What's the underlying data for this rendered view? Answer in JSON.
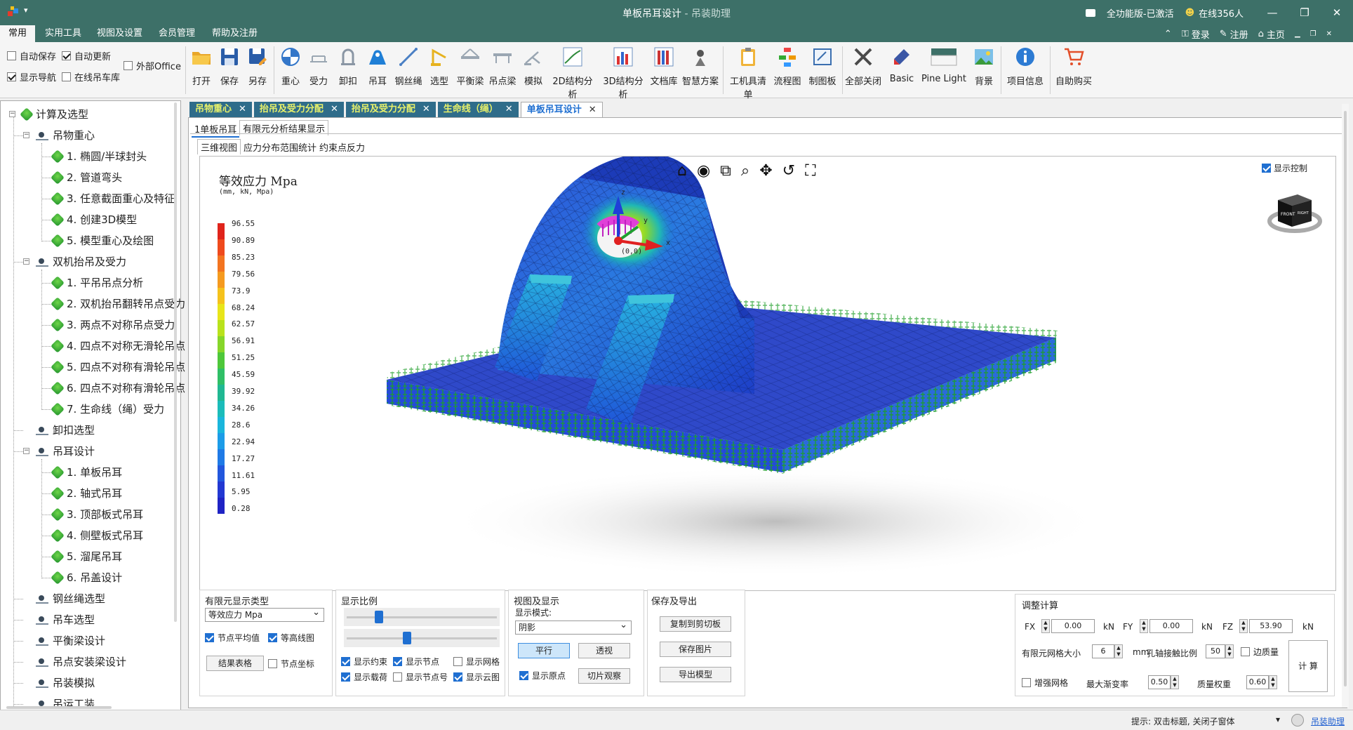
{
  "window": {
    "title": "单板吊耳设计",
    "title_sep": " - ",
    "subtitle": "吊装助理",
    "license": "全功能版-已激活",
    "online": "在线356人"
  },
  "menu": {
    "tabs": [
      "常用",
      "实用工具",
      "视图及设置",
      "会员管理",
      "帮助及注册"
    ],
    "login": "登录",
    "register": "注册",
    "home": "主页"
  },
  "ribbon": {
    "options": {
      "autosave": "自动保存",
      "autoupdate": "自动更新",
      "external_office": "外部Office",
      "show_nav": "显示导航",
      "online_crane_lib": "在线吊车库"
    },
    "buttons": {
      "open": "打开",
      "save": "保存",
      "save_as": "另存",
      "cog": "重心",
      "force": "受力",
      "shackle": "卸扣",
      "lug": "吊耳",
      "wire_rope": "钢丝绳",
      "selection": "选型",
      "spreader": "平衡梁",
      "lifting_beam": "吊点梁",
      "simulate": "模拟",
      "fea2d": "2D结构分析",
      "fea3d": "3D结构分析",
      "doclib": "文档库",
      "smart": "智慧方案",
      "tool_list": "工机具清单",
      "flowchart": "流程图",
      "drawing": "制图板",
      "close_all": "全部关闭",
      "basic": "Basic",
      "pine_light": "Pine Light",
      "background": "背景",
      "project_info": "项目信息",
      "shop": "自助购买"
    }
  },
  "tree": {
    "root": "计算及选型",
    "groups": [
      {
        "label": "吊物重心",
        "items": [
          "1. 椭圆/半球封头",
          "2. 管道弯头",
          "3. 任意截面重心及特征",
          "4. 创建3D模型",
          "5. 模型重心及绘图"
        ]
      },
      {
        "label": "双机抬吊及受力",
        "items": [
          "1. 平吊吊点分析",
          "2. 双机抬吊翻转吊点受力",
          "3. 两点不对称吊点受力",
          "4. 四点不对称无滑轮吊点",
          "5. 四点不对称有滑轮吊点",
          "6. 四点不对称有滑轮吊点",
          "7. 生命线（绳）受力"
        ]
      },
      {
        "label": "卸扣选型",
        "items": []
      },
      {
        "label": "吊耳设计",
        "items": [
          "1. 单板吊耳",
          "2. 轴式吊耳",
          "3. 顶部板式吊耳",
          "4. 侧壁板式吊耳",
          "5. 溜尾吊耳",
          "6. 吊盖设计"
        ]
      },
      {
        "label": "钢丝绳选型",
        "items": []
      },
      {
        "label": "吊车选型",
        "items": []
      },
      {
        "label": "平衡梁设计",
        "items": []
      },
      {
        "label": "吊点安装梁设计",
        "items": []
      },
      {
        "label": "吊装模拟",
        "items": []
      },
      {
        "label": "吊运工装",
        "items": []
      }
    ]
  },
  "doc_tabs": [
    "吊物重心",
    "抬吊及受力分配",
    "抬吊及受力分配",
    "生命线（绳）",
    "单板吊耳设计"
  ],
  "sub_tabs": [
    "1单板吊耳",
    "有限元分析结果显示"
  ],
  "view_tabs": [
    "三维视图",
    "应力分布范围统计",
    "约束点反力"
  ],
  "viewport": {
    "legend_title": "等效应力 Mpa",
    "legend_unit": "(mm, kN, Mpa)",
    "legend_values": [
      "96.55",
      "90.89",
      "85.23",
      "79.56",
      "73.9",
      "68.24",
      "62.57",
      "56.91",
      "51.25",
      "45.59",
      "39.92",
      "34.26",
      "28.6",
      "22.94",
      "17.27",
      "11.61",
      "5.95",
      "0.28"
    ],
    "legend_colors": [
      "#e0241b",
      "#ef4a1d",
      "#f37420",
      "#f59a1f",
      "#f5c21c",
      "#e8e51a",
      "#b9e21c",
      "#86d62a",
      "#4ec83a",
      "#2fbf66",
      "#20b892",
      "#1bbcba",
      "#1ab6dc",
      "#1c9ce8",
      "#1f7ae6",
      "#2257dd",
      "#2238d2",
      "#1f23c4"
    ],
    "display_control": "显示控制",
    "cube_front": "FRONT",
    "cube_right": "RIGHT",
    "origin": "(0,0)",
    "axis_x": "x",
    "axis_y": "y",
    "axis_z": "z"
  },
  "controls": {
    "fe_type": {
      "title": "有限元显示类型",
      "value": "等效应力 Mpa",
      "node_avg": "节点平均值",
      "contour": "等高线图",
      "result_table": "结果表格",
      "node_coords": "节点坐标"
    },
    "scale": {
      "title": "显示比例",
      "show_constraint": "显示约束",
      "show_nodes": "显示节点",
      "show_mesh": "显示网格",
      "show_load": "显示载荷",
      "show_node_no": "显示节点号",
      "show_cloud": "显示云图",
      "slider1": 0.2,
      "slider2": 0.4
    },
    "view": {
      "title": "视图及显示",
      "mode_label": "显示模式:",
      "mode_value": "阴影",
      "parallel": "平行",
      "perspective": "透视",
      "show_origin": "显示原点",
      "slice": "切片观察"
    },
    "export": {
      "title": "保存及导出",
      "copy": "复制到剪切板",
      "save_image": "保存图片",
      "export_model": "导出模型"
    },
    "adjust": {
      "title": "调整计算",
      "fx_label": "FX",
      "fx": "0.00",
      "fy_label": "FY",
      "fy": "0.00",
      "fz_label": "FZ",
      "fz": "53.90",
      "unit_kn": "kN",
      "mesh_label": "有限元网格大小",
      "mesh": "6",
      "mm": "mm",
      "contact_label": "孔轴接触比例",
      "contact": "50",
      "edge_mass": "边质量",
      "refine": "增强网格",
      "max_gradient_label": "最大渐变率",
      "max_gradient": "0.50",
      "mass_weight_label": "质量权重",
      "mass_weight": "0.60",
      "calc": "计 算"
    }
  },
  "status": {
    "hint": "提示: 双击标题, 关闭子窗体",
    "assistant": "吊装助理"
  }
}
